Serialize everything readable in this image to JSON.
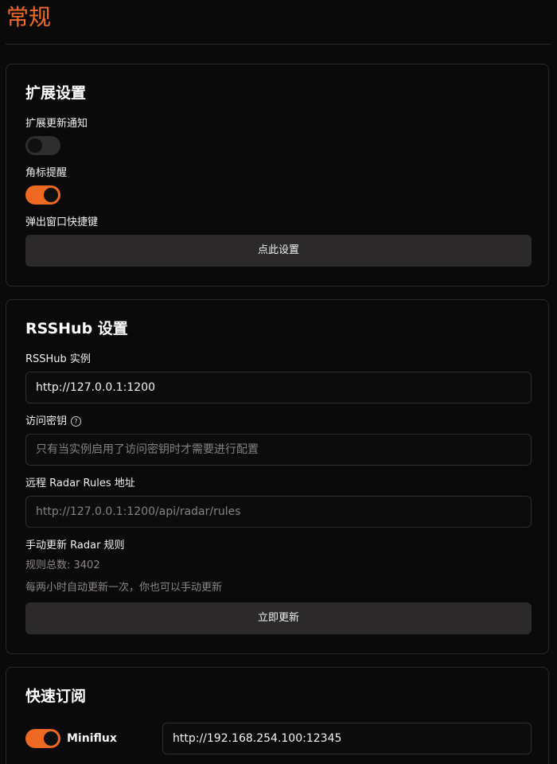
{
  "page": {
    "title": "常规"
  },
  "extension_settings": {
    "title": "扩展设置",
    "update_notice_label": "扩展更新通知",
    "update_notice_enabled": false,
    "badge_label": "角标提醒",
    "badge_enabled": true,
    "shortcut_label": "弹出窗口快捷键",
    "shortcut_button": "点此设置"
  },
  "rsshub_settings": {
    "title": "RSSHub 设置",
    "instance_label": "RSSHub 实例",
    "instance_value": "http://127.0.0.1:1200",
    "access_key_label": "访问密钥",
    "access_key_help_icon": "help-circle-icon",
    "access_key_placeholder": "只有当实例启用了访问密钥时才需要进行配置",
    "radar_rules_label": "远程 Radar Rules 地址",
    "radar_rules_placeholder": "http://127.0.0.1:1200/api/radar/rules",
    "manual_update_label": "手动更新 Radar 规则",
    "rules_total": "规则总数: 3402",
    "auto_update_note": "每两小时自动更新一次，你也可以手动更新",
    "update_button": "立即更新"
  },
  "quick_subscribe": {
    "title": "快速订阅",
    "miniflux_label": "Miniflux",
    "miniflux_enabled": true,
    "miniflux_url": "http://192.168.254.100:12345"
  },
  "colors": {
    "accent": "#ee6a22",
    "background": "#0b0a0a",
    "card_border": "#2b2929",
    "button_bg": "#2b2929"
  }
}
